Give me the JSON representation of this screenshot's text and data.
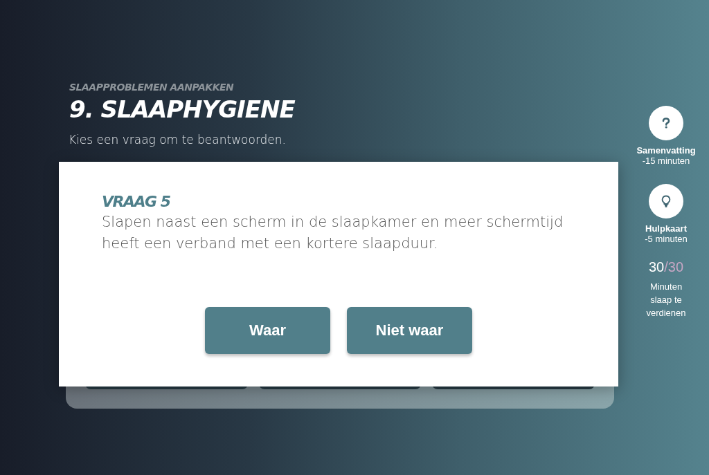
{
  "header": {
    "eyebrow": "SLAAPPROBLEMEN AANPAKKEN",
    "title": "9. SLAAPHYGIENE",
    "instruction": "Kies een vraag om te beantwoorden."
  },
  "dialog": {
    "label": "VRAAG 5",
    "question": "Slapen naast een scherm in de slaapkamer en meer schermtijd heeft een verband met een kortere slaapduur.",
    "buttons": [
      "Waar",
      "Niet waar"
    ]
  },
  "sidebar": {
    "helps": [
      {
        "kind": "question",
        "label": "Samenvatting",
        "cost": "-15 minuten"
      },
      {
        "kind": "bulb",
        "label": "Hulpkaart",
        "cost": "-5 minuten"
      }
    ],
    "score": {
      "value": "30",
      "total": "/30"
    },
    "caption": "Minuten slaap te verdienen"
  }
}
